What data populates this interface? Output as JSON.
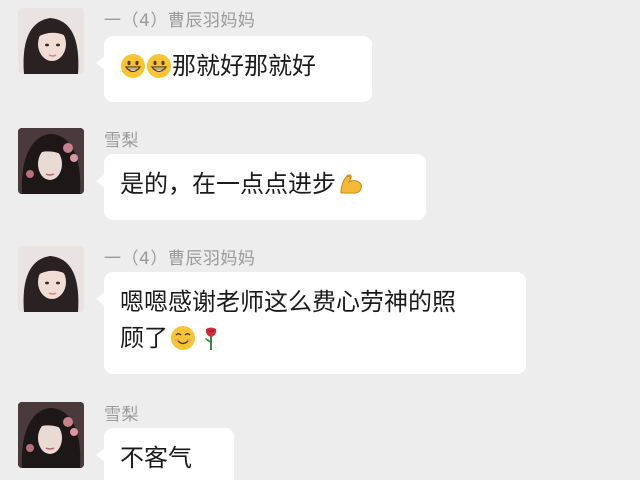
{
  "messages": [
    {
      "sender": "一（4）曹辰羽妈妈",
      "text": "那就好那就好",
      "emojis_before": [
        "grinning-face-icon",
        "grinning-face-icon"
      ]
    },
    {
      "sender": "雪梨",
      "text": "是的，在一点点进步",
      "emojis_after": [
        "flexed-biceps-icon"
      ]
    },
    {
      "sender": "一（4）曹辰羽妈妈",
      "text_line1": "嗯嗯感谢老师这么费心劳神的照",
      "text_line2": "顾了",
      "emojis_after": [
        "smiling-face-icon",
        "rose-icon"
      ]
    },
    {
      "sender": "雪梨",
      "text": "不客气"
    }
  ],
  "colors": {
    "background": "#ededed",
    "bubble": "#ffffff",
    "sender_text": "#9a9a9a",
    "message_text": "#1b1b1b"
  }
}
